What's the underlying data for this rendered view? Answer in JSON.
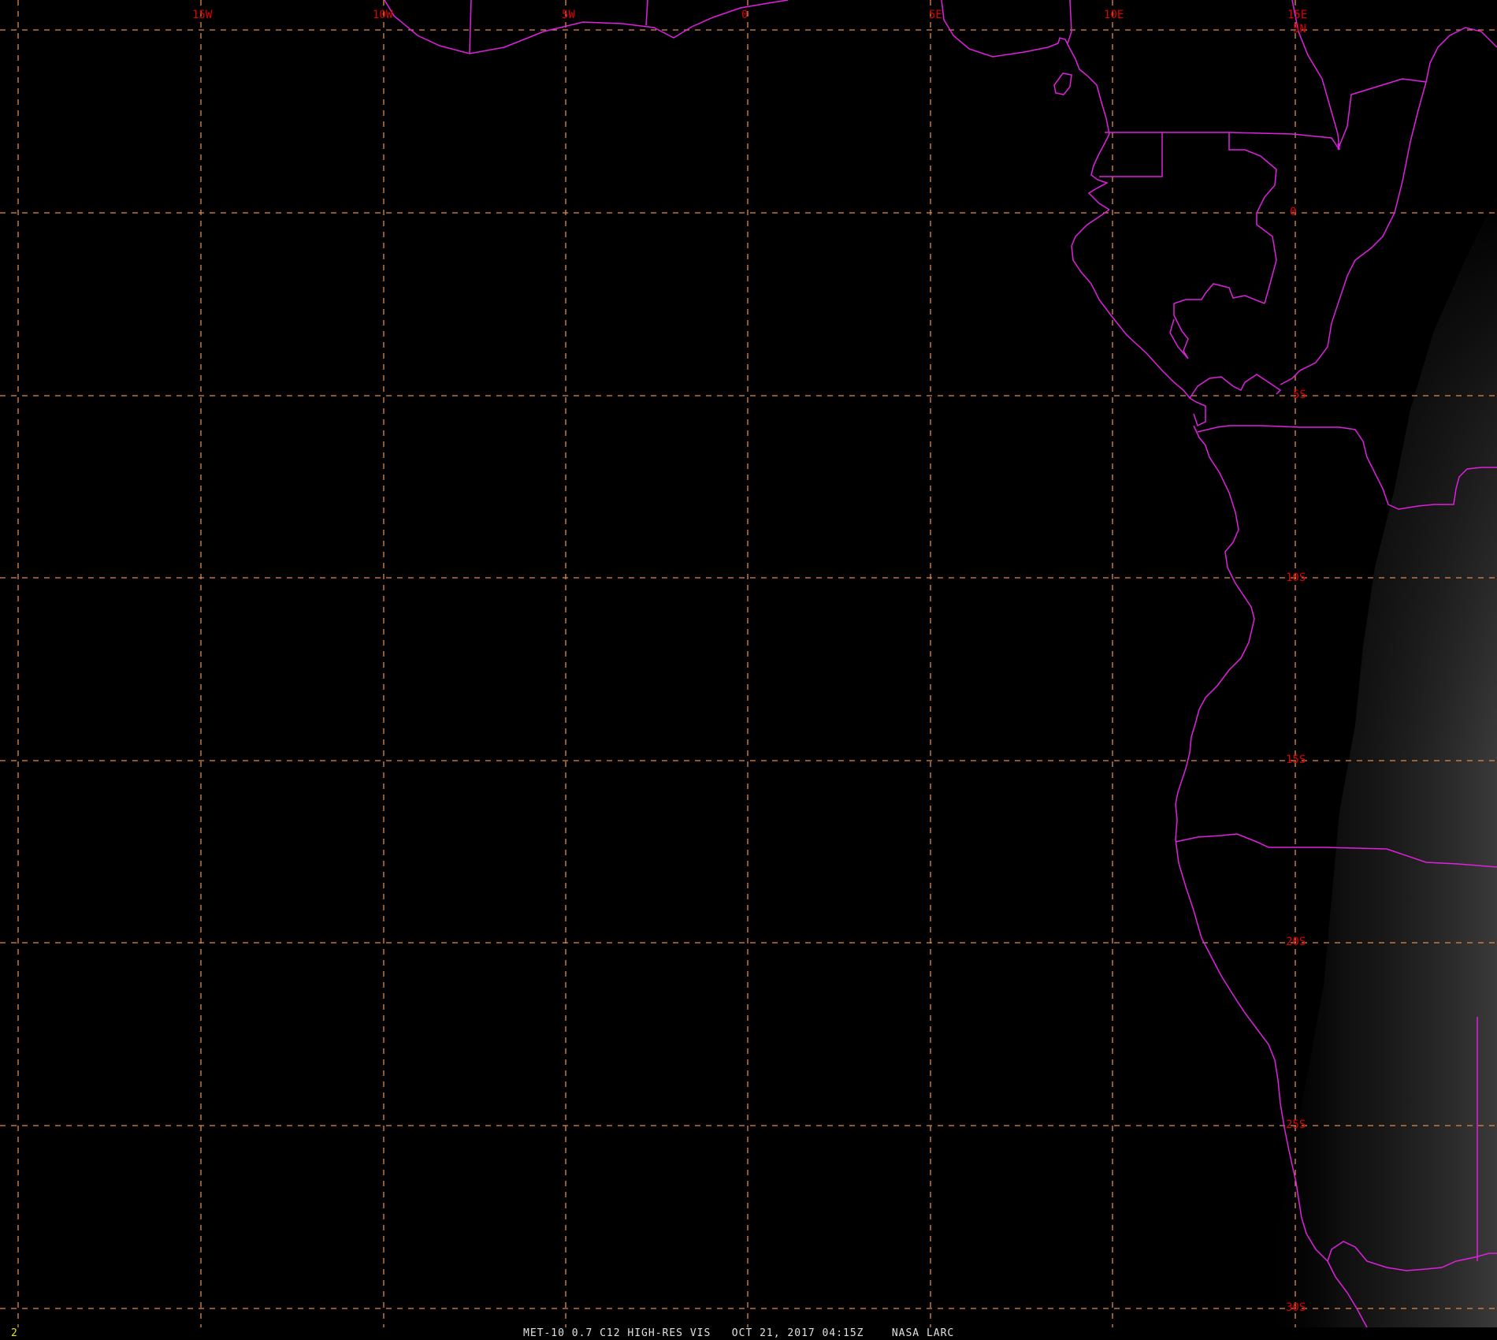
{
  "colors": {
    "background": "#000000",
    "graticule": "#e08a4a",
    "grid_labels": "#e00000",
    "boundaries": "#e020e0",
    "frame_number": "#e8e800",
    "caption": "#e0e0e0"
  },
  "graticule": {
    "lon_labels": [
      "15W",
      "10W",
      "5W",
      "0",
      "5E",
      "10E",
      "15E"
    ],
    "lat_labels": [
      "5N",
      "0",
      "5S",
      "10S",
      "15S",
      "20S",
      "25S",
      "30S"
    ]
  },
  "caption": {
    "frame_number": "2",
    "text": "MET-10 0.7 C12 HIGH-RES VIS   OCT 21, 2017 04:15Z    NASA LARC"
  }
}
